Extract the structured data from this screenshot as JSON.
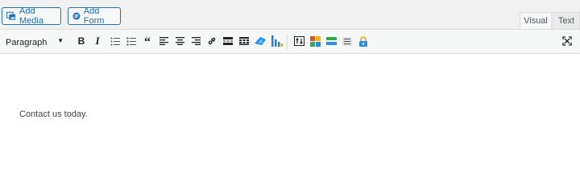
{
  "media_buttons": {
    "add_media": "Add Media",
    "add_form": "Add Form"
  },
  "tabs": {
    "visual": "Visual",
    "text": "Text"
  },
  "toolbar": {
    "format_select": "Paragraph",
    "bold": "B",
    "italic": "I",
    "blockquote": "“",
    "icons": [
      "bold-icon",
      "italic-icon",
      "bulleted-list-icon",
      "numbered-list-icon",
      "blockquote-icon",
      "align-left-icon",
      "align-center-icon",
      "align-right-icon",
      "link-icon",
      "read-more-icon",
      "toolbar-toggle-icon",
      "plugin-blue-icon",
      "chart-bars-icon",
      "plugin-arrows-icon",
      "plugin-grid-icon",
      "plugin-green-icon",
      "plugin-list-icon",
      "plugin-lock-icon",
      "fullscreen-icon"
    ]
  },
  "editor": {
    "content": "Contact us today."
  },
  "colors": {
    "accent": "#2271b1",
    "toolbar_bg": "#f6f7f7",
    "editor_bg": "#ffffff"
  }
}
